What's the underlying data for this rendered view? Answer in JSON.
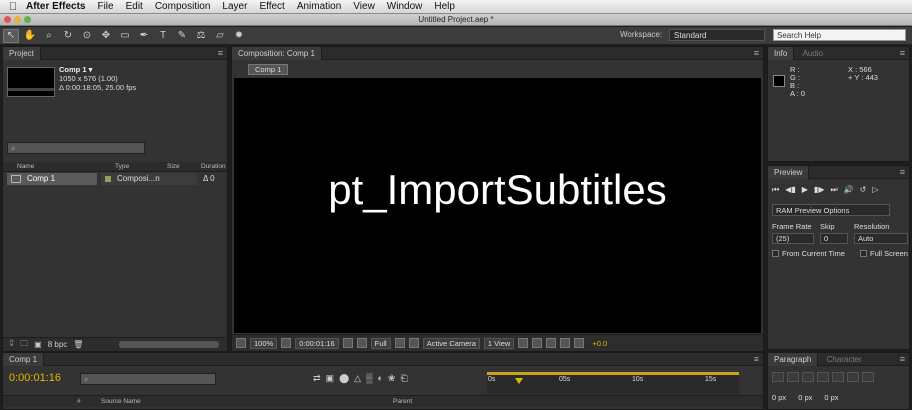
{
  "menubar": {
    "app_name": "After Effects",
    "items": [
      "File",
      "Edit",
      "Composition",
      "Layer",
      "Effect",
      "Animation",
      "View",
      "Window",
      "Help"
    ]
  },
  "window": {
    "title": "Untitled Project.aep *"
  },
  "toolbar": {
    "tools": [
      "selection-tool",
      "hand-tool",
      "zoom-tool",
      "rotation-tool",
      "orbit-camera-tool",
      "pan-behind-tool",
      "rectangle-mask-tool",
      "pen-tool",
      "type-tool",
      "brush-tool",
      "clone-stamp-tool",
      "eraser-tool",
      "puppet-pin-tool"
    ],
    "workspace_label": "Workspace:",
    "workspace_value": "Standard",
    "search_placeholder": "Search Help"
  },
  "project": {
    "tab": "Project",
    "item_name": "Comp 1 ▾",
    "item_size": "1050 x 576 (1.00)",
    "item_duration": "Δ 0:00:18:05, 25.00 fps",
    "search_placeholder": "",
    "columns": {
      "name": "Name",
      "type": "Type",
      "size": "Size",
      "duration": "Duration"
    },
    "row": {
      "name": "Comp 1",
      "type": "Composi...n",
      "duration": "Δ 0"
    },
    "bpc": "8 bpc"
  },
  "composition": {
    "tab": "Composition: Comp 1",
    "subtab": "Comp 1",
    "viewer_text": "pt_ImportSubtitles",
    "zoom": "100%",
    "timecode": "0:00:01:16",
    "resolution": "Full",
    "camera": "Active Camera",
    "views": "1 View",
    "exposure": "+0.0"
  },
  "info": {
    "tabs": [
      "Info",
      "Audio"
    ],
    "r": "R :",
    "g": "G :",
    "b": "B :",
    "a": "A : 0",
    "x": "X : 566",
    "y": "+ Y : 443"
  },
  "preview": {
    "tab": "Preview",
    "ram_option": "RAM Preview Options",
    "frame_rate_label": "Frame Rate",
    "frame_rate_value": "(25)",
    "skip_label": "Skip",
    "skip_value": "0",
    "resolution_label": "Resolution",
    "resolution_value": "Auto",
    "from_current": "From Current Time",
    "full_screen": "Full Screen"
  },
  "timeline": {
    "tab": "Comp 1",
    "timecode": "0:00:01:16",
    "ruler_ticks": [
      "0s",
      "05s",
      "10s",
      "15s"
    ],
    "columns": {
      "source_name": "Source Name",
      "parent": "Parent",
      "num": "#"
    }
  },
  "paragraph": {
    "tabs": [
      "Paragraph",
      "Character"
    ],
    "indent_left": "0 px",
    "indent_right": "0 px",
    "indent_first": "0 px"
  },
  "colors": {
    "accent": "#e5b800",
    "panel": "#333333",
    "viewer": "#000000"
  }
}
